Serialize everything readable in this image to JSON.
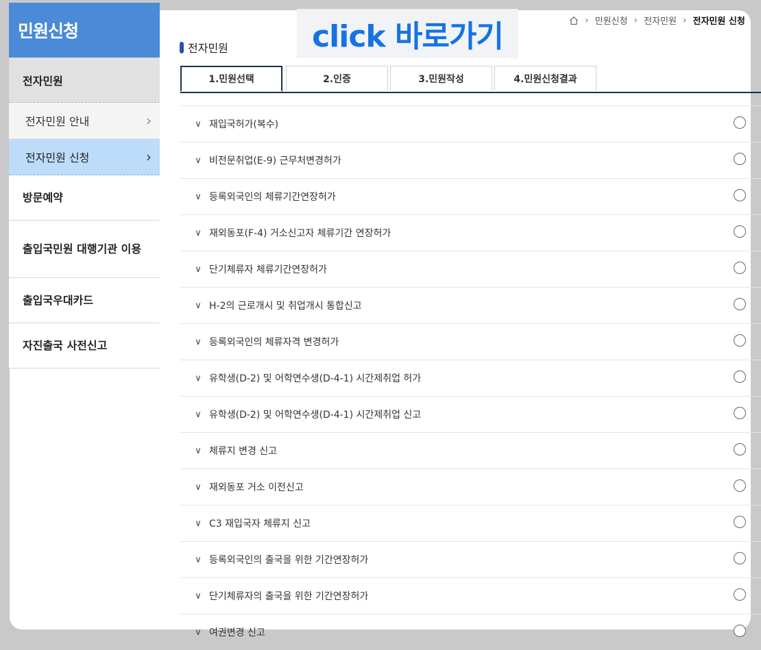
{
  "sidebar": {
    "header": "민원신청",
    "active_section": "전자민원",
    "sub_items": [
      {
        "label": "전자민원 안내"
      },
      {
        "label": "전자민원 신청"
      }
    ],
    "items": [
      {
        "label": "방문예약"
      },
      {
        "label": "출입국민원 대행기관 이용"
      },
      {
        "label": "출입국우대카드"
      },
      {
        "label": "자진출국 사전신고"
      }
    ]
  },
  "banner": {
    "text": "click 바로가기"
  },
  "breadcrumb": {
    "items": [
      "민원신청",
      "전자민원",
      "전자민원 신청"
    ]
  },
  "page": {
    "title": "전자민원"
  },
  "tabs": [
    "1.민원선택",
    "2.인증",
    "3.민원작성",
    "4.민원신청결과"
  ],
  "list": [
    "재입국허가(복수)",
    "비전문취업(E-9) 근무처변경허가",
    "등록외국인의 체류기간연장허가",
    "재외동포(F-4) 거소신고자 체류기간 연장허가",
    "단기체류자 체류기간연장허가",
    "H-2의 근로개시 및 취업개시 통합신고",
    "등록외국인의 체류자격 변경허가",
    "유학생(D-2) 및 어학연수생(D-4-1) 시간제취업 허가",
    "유학생(D-2) 및 어학연수생(D-4-1) 시간제취업 신고",
    "체류지 변경 신고",
    "재외동포 거소 이전신고",
    "C3 재입국자 체류지 신고",
    "등록외국인의 출국을 위한 기간연장허가",
    "단기체류자의 출국을 위한 기간연장허가",
    "여권변경 신고"
  ],
  "colors": {
    "accent": "#4a8ad6",
    "tab_border": "#1d2d50",
    "banner_text": "#1673e0"
  }
}
